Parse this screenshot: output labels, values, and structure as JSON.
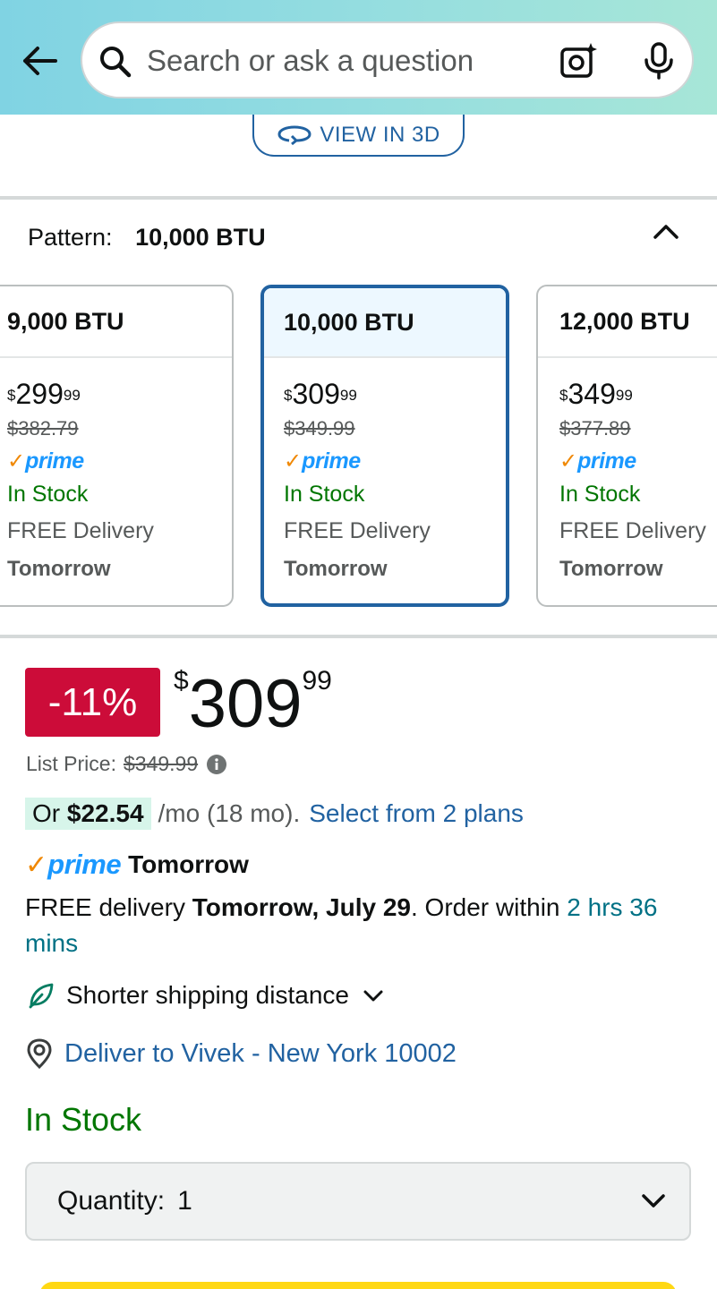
{
  "search": {
    "placeholder": "Search or ask a question"
  },
  "view3d": {
    "label": "VIEW IN 3D"
  },
  "pattern": {
    "label": "Pattern:",
    "value": "10,000 BTU"
  },
  "variants": [
    {
      "name": "9,000 BTU",
      "price_whole": "299",
      "price_cents": "99",
      "currency": "$",
      "list_price": "$382.79",
      "prime": "prime",
      "stock": "In Stock",
      "delivery": "FREE Delivery",
      "when": "Tomorrow",
      "selected": false
    },
    {
      "name": "10,000 BTU",
      "price_whole": "309",
      "price_cents": "99",
      "currency": "$",
      "list_price": "$349.99",
      "prime": "prime",
      "stock": "In Stock",
      "delivery": "FREE Delivery",
      "when": "Tomorrow",
      "selected": true
    },
    {
      "name": "12,000 BTU",
      "price_whole": "349",
      "price_cents": "99",
      "currency": "$",
      "list_price": "$377.89",
      "prime": "prime",
      "stock": "In Stock",
      "delivery": "FREE Delivery",
      "when": "Tomorrow",
      "selected": false
    }
  ],
  "pricing": {
    "discount": "-11%",
    "currency": "$",
    "whole": "309",
    "cents": "99",
    "list_label": "List Price:",
    "list_value": "$349.99"
  },
  "financing": {
    "or": "Or ",
    "amount": "$22.54",
    "term": "/mo (18 mo).",
    "link": "Select from 2 plans"
  },
  "prime_delivery": {
    "badge": "prime",
    "label": "Tomorrow"
  },
  "free_delivery": {
    "prefix": "FREE delivery ",
    "date": "Tomorrow, July 29",
    "mid": ". Order within ",
    "countdown": "2 hrs 36 mins"
  },
  "shipping": {
    "label": "Shorter shipping distance"
  },
  "deliver_to": {
    "label": "Deliver to Vivek - New York 10002"
  },
  "stock": {
    "label": "In Stock"
  },
  "quantity": {
    "label": "Quantity:",
    "value": "1"
  },
  "colors": {
    "accent": "#2162a1",
    "deal": "#cc0c39",
    "stock": "#007600",
    "prime": "#1a98ff",
    "buy": "#ffd814"
  }
}
